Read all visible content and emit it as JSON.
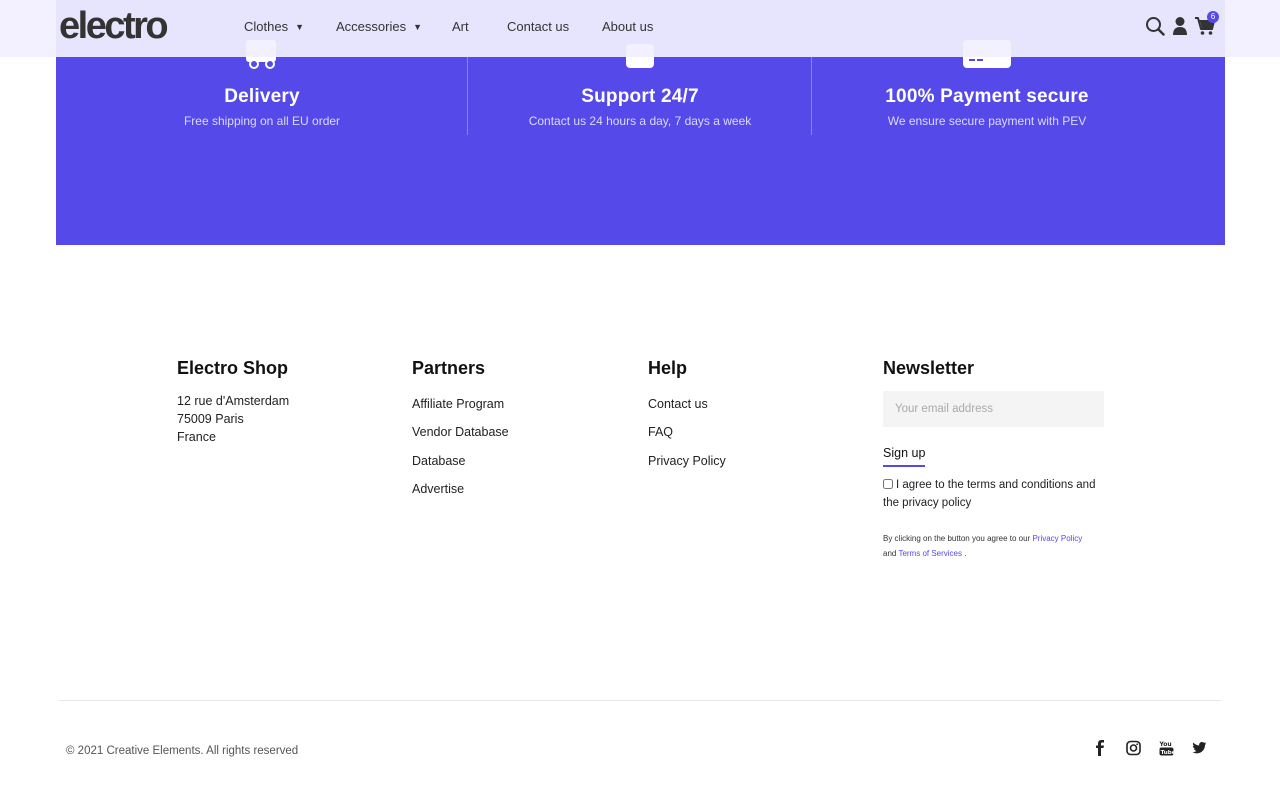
{
  "header": {
    "logo": "electro",
    "nav": [
      {
        "label": "Clothes",
        "has_dropdown": true
      },
      {
        "label": "Accessories",
        "has_dropdown": true
      },
      {
        "label": "Art",
        "has_dropdown": false
      },
      {
        "label": "Contact us",
        "has_dropdown": false
      },
      {
        "label": "About us",
        "has_dropdown": false
      }
    ],
    "icons": [
      "search-icon",
      "user-icon",
      "cart-icon"
    ],
    "cart_count": "6"
  },
  "features": [
    {
      "icon": "truck-icon",
      "title": "Delivery",
      "subtitle": "Free shipping on all EU order"
    },
    {
      "icon": "support-icon",
      "title": "Support 24/7",
      "subtitle": "Contact us 24 hours a day, 7 days a week"
    },
    {
      "icon": "credit-card-icon",
      "title": "100% Payment secure",
      "subtitle": "We ensure secure payment with PEV"
    }
  ],
  "footer": {
    "shop": {
      "title": "Electro Shop",
      "address": [
        "12 rue d'Amsterdam",
        "75009 Paris",
        "France"
      ]
    },
    "partners": {
      "title": "Partners",
      "links": [
        "Affiliate Program",
        "Vendor Database",
        "Database",
        "Advertise"
      ]
    },
    "help": {
      "title": "Help",
      "links": [
        "Contact us",
        "FAQ",
        "Privacy Policy"
      ]
    },
    "newsletter": {
      "title": "Newsletter",
      "email_placeholder": "Your email address",
      "signup_label": "Sign up",
      "agree_text": "I agree to the terms and conditions and the privacy policy",
      "legal_prefix": "By clicking on the button you agree to our",
      "privacy_link": "Privacy Policy",
      "legal_and": "and",
      "terms_link": "Terms of Services",
      "legal_suffix": "."
    },
    "copyright": "© 2021 Creative Elements. All rights reserved",
    "social": [
      "facebook-icon",
      "instagram-icon",
      "youtube-icon",
      "twitter-icon"
    ]
  },
  "colors": {
    "accent": "#5549ea",
    "header_bg": "#f2f0ff",
    "text": "#222222"
  }
}
